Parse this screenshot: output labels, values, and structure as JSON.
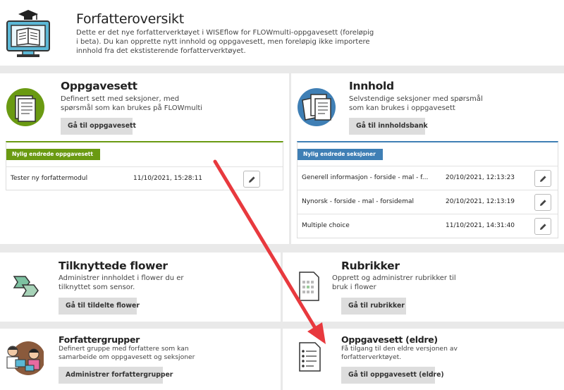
{
  "header": {
    "title": "Forfatteroversikt",
    "description_line1": "Dette er det nye forfatterverktøyet i WISEflow for FLOWmulti-oppgavesett (foreløpig",
    "description_line2": "i beta). Du kan opprette nytt innhold og oppgavesett, men foreløpig ikke importere",
    "description_line3": "innhold fra det ekstisterende forfatterverktøyet."
  },
  "oppgavesett": {
    "title": "Oppgavesett",
    "desc_line1": "Definert sett med seksjoner, med",
    "desc_line2": "spørsmål som kan brukes på FLOWmulti",
    "button": "Gå til oppgavesett",
    "ribbon": "Nylig endrede oppgavesett",
    "rows": [
      {
        "name": "Tester ny forfattermodul",
        "date": "11/10/2021, 15:28:11"
      }
    ]
  },
  "innhold": {
    "title": "Innhold",
    "desc_line1": "Selvstendige seksjoner med spørsmål",
    "desc_line2": "som kan brukes i oppgavesett",
    "button": "Gå til innholdsbank",
    "ribbon": "Nylig endrede seksjoner",
    "rows": [
      {
        "name": "Generell informasjon - forside - mal - f...",
        "date": "20/10/2021, 12:13:23"
      },
      {
        "name": "Nynorsk - forside - mal - forsidemal",
        "date": "20/10/2021, 12:13:19"
      },
      {
        "name": "Multiple choice",
        "date": "11/10/2021, 14:31:40"
      }
    ]
  },
  "flower": {
    "title": "Tilknyttede flower",
    "desc_line1": "Administrer innholdet i flower du er",
    "desc_line2": "tilknyttet som sensor.",
    "button": "Gå til tildelte flower"
  },
  "rubrikker": {
    "title": "Rubrikker",
    "desc_line1": "Opprett og administrer rubrikker til",
    "desc_line2": "bruk i flower",
    "button": "Gå til rubrikker"
  },
  "forfattergrupper": {
    "title": "Forfattergrupper",
    "desc_line1": "Definert gruppe med forfattere som kan",
    "desc_line2": "samarbeide om oppgavesett og seksjoner",
    "button": "Administrer forfattergrupper"
  },
  "eldre": {
    "title": "Oppgavesett (eldre)",
    "desc_line1": "Få tilgang til den eldre versjonen av",
    "desc_line2": "forfatterverktøyet.",
    "button": "Gå til oppgavesett (eldre)"
  },
  "colors": {
    "green": "#6a9a12",
    "blue": "#3f7fb5",
    "arrow": "#e8393e"
  }
}
